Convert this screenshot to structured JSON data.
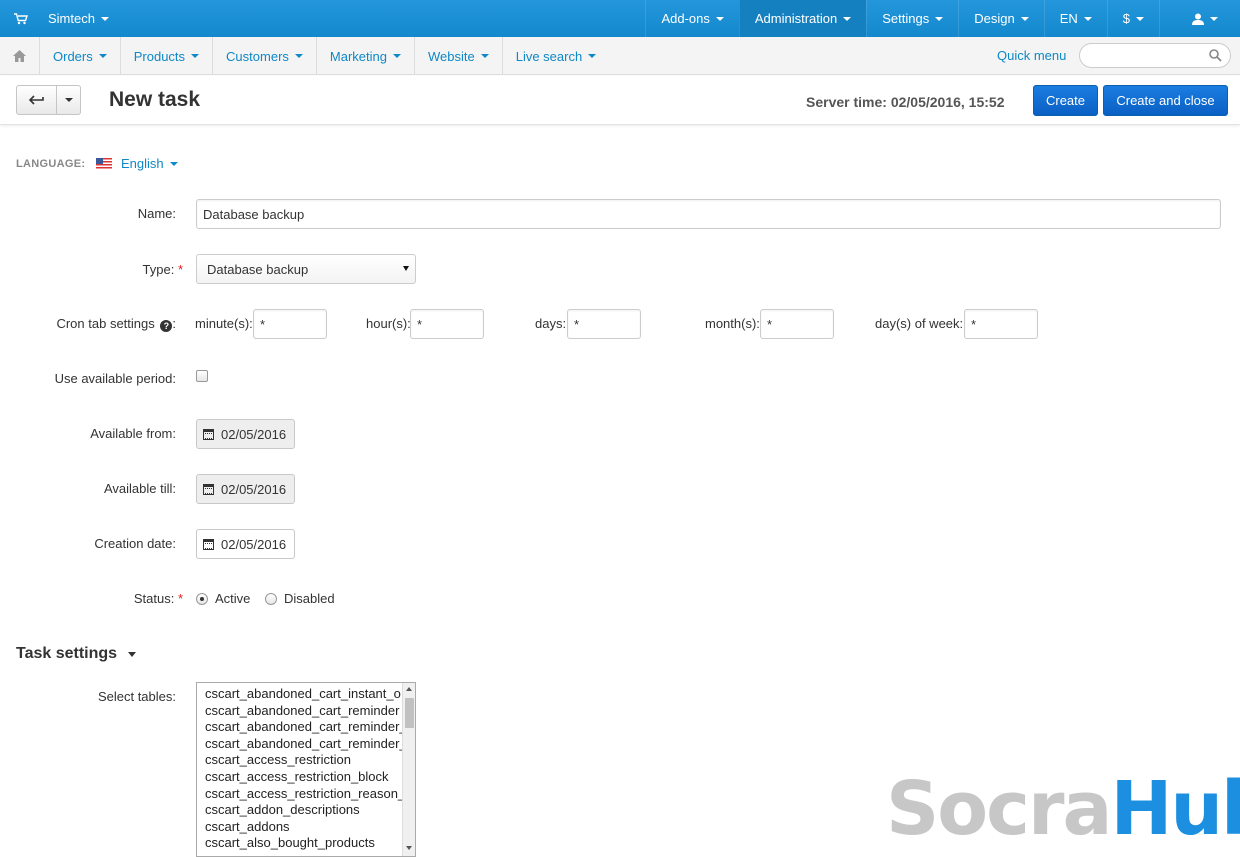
{
  "topbar": {
    "store": "Simtech",
    "nav": [
      "Add-ons",
      "Administration",
      "Settings",
      "Design",
      "EN",
      "$"
    ]
  },
  "menu": {
    "items": [
      "Orders",
      "Products",
      "Customers",
      "Marketing",
      "Website",
      "Live search"
    ],
    "quick_menu": "Quick menu"
  },
  "titlebar": {
    "title": "New task",
    "server_time": "Server time: 02/05/2016, 15:52",
    "create": "Create",
    "create_close": "Create and close"
  },
  "form": {
    "language_label": "LANGUAGE:",
    "language": "English",
    "name_label": "Name:",
    "name_value": "Database backup",
    "type_label": "Type:",
    "type_value": "Database backup",
    "cron_label": "Cron tab settings",
    "minute_label": "minute(s):",
    "hour_label": "hour(s):",
    "days_label": "days:",
    "month_label": "month(s):",
    "dow_label": "day(s) of week:",
    "minute": "*",
    "hour": "*",
    "days": "*",
    "month": "*",
    "dow": "*",
    "period_label": "Use available period:",
    "from_label": "Available from:",
    "from_value": "02/05/2016",
    "till_label": "Available till:",
    "till_value": "02/05/2016",
    "created_label": "Creation date:",
    "created_value": "02/05/2016",
    "status_label": "Status:",
    "status_active": "Active",
    "status_disabled": "Disabled"
  },
  "task_settings": {
    "title": "Task settings",
    "tables_label": "Select tables:",
    "tables": [
      "cscart_abandoned_cart_instant_o",
      "cscart_abandoned_cart_reminder",
      "cscart_abandoned_cart_reminder_",
      "cscart_abandoned_cart_reminder_",
      "cscart_access_restriction",
      "cscart_access_restriction_block",
      "cscart_access_restriction_reason_",
      "cscart_addon_descriptions",
      "cscart_addons",
      "cscart_also_bought_products"
    ]
  },
  "watermark": {
    "part1": "Socra",
    "part2": "Hub"
  },
  "colors": {
    "topbar": "#1a8ed3",
    "link": "#0e88c6",
    "button": "#0b60c4"
  }
}
